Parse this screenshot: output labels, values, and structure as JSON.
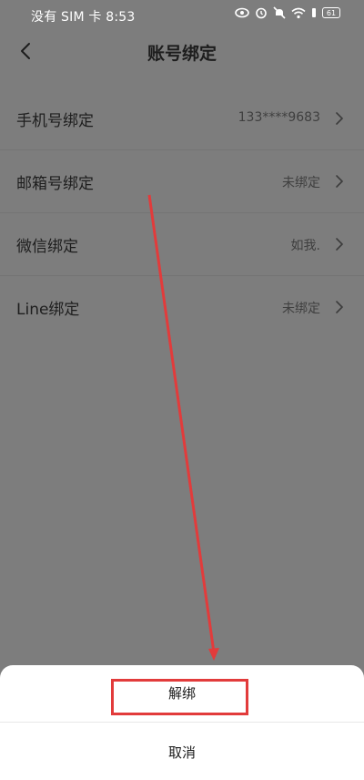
{
  "status_bar": {
    "carrier_time": "没有 SIM 卡 8:53",
    "battery": "61",
    "icons": [
      "eye-icon",
      "alarm-icon",
      "mute-icon",
      "wifi-icon",
      "battery-icon"
    ]
  },
  "header": {
    "back_icon": "chevron-left-icon",
    "title": "账号绑定"
  },
  "bindings": [
    {
      "label": "手机号绑定",
      "value": "133****9683"
    },
    {
      "label": "邮箱号绑定",
      "value": "未绑定"
    },
    {
      "label": "微信绑定",
      "value": "如我."
    },
    {
      "label": "Line绑定",
      "value": "未绑定"
    }
  ],
  "action_sheet": {
    "unbind_label": "解绑",
    "cancel_label": "取消"
  },
  "colors": {
    "overlay": "#7d7d7d",
    "annotation_red": "#e23b3b",
    "sheet_bg": "#ffffff"
  }
}
